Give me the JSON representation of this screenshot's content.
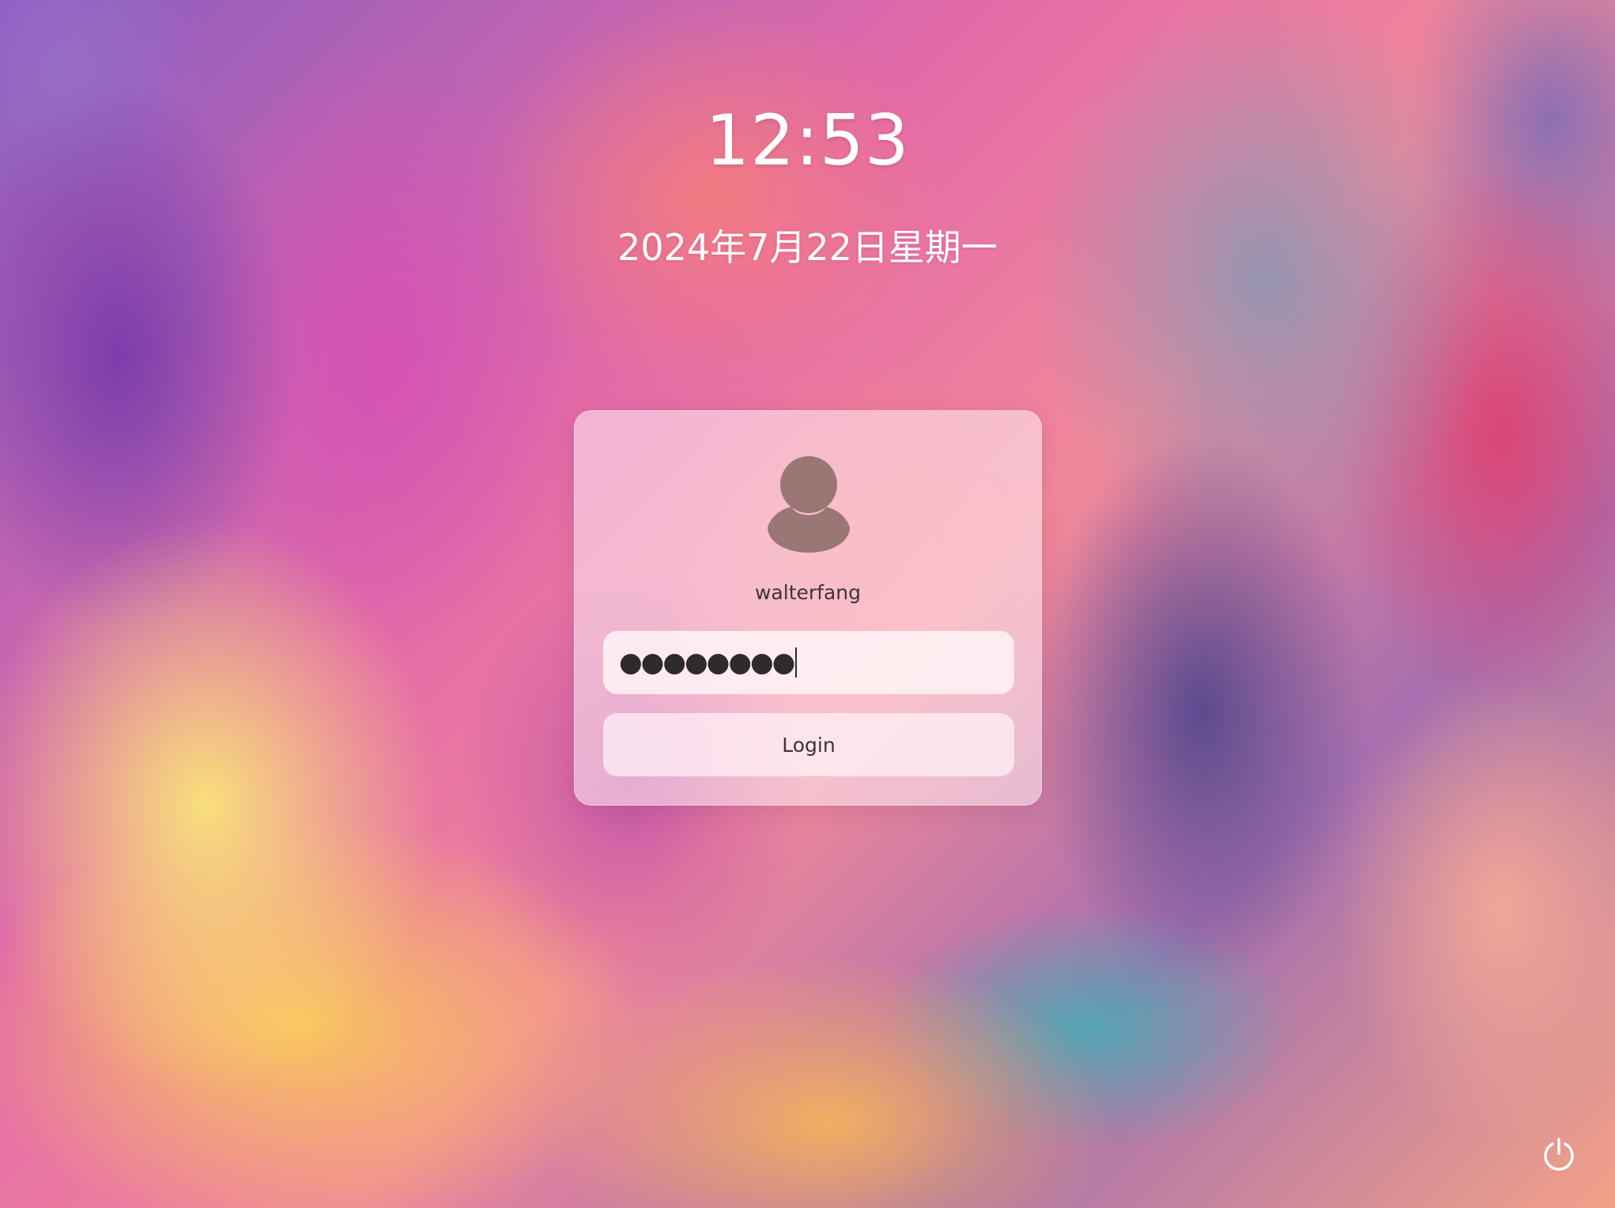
{
  "lock_screen": {
    "time": "12:53",
    "date": "2024年7月22日星期一"
  },
  "login_card": {
    "avatar_icon": "user-avatar-icon",
    "username": "walterfang",
    "password": {
      "masked_value": "●●●●●●●●",
      "character_count": 8
    },
    "login_button_label": "Login"
  },
  "system": {
    "power_icon": "power-icon"
  },
  "colors": {
    "card_background": "#fbe3ea",
    "text_dark": "#3d3438",
    "avatar_color": "#9a7674",
    "clock_text": "#ffffff"
  }
}
